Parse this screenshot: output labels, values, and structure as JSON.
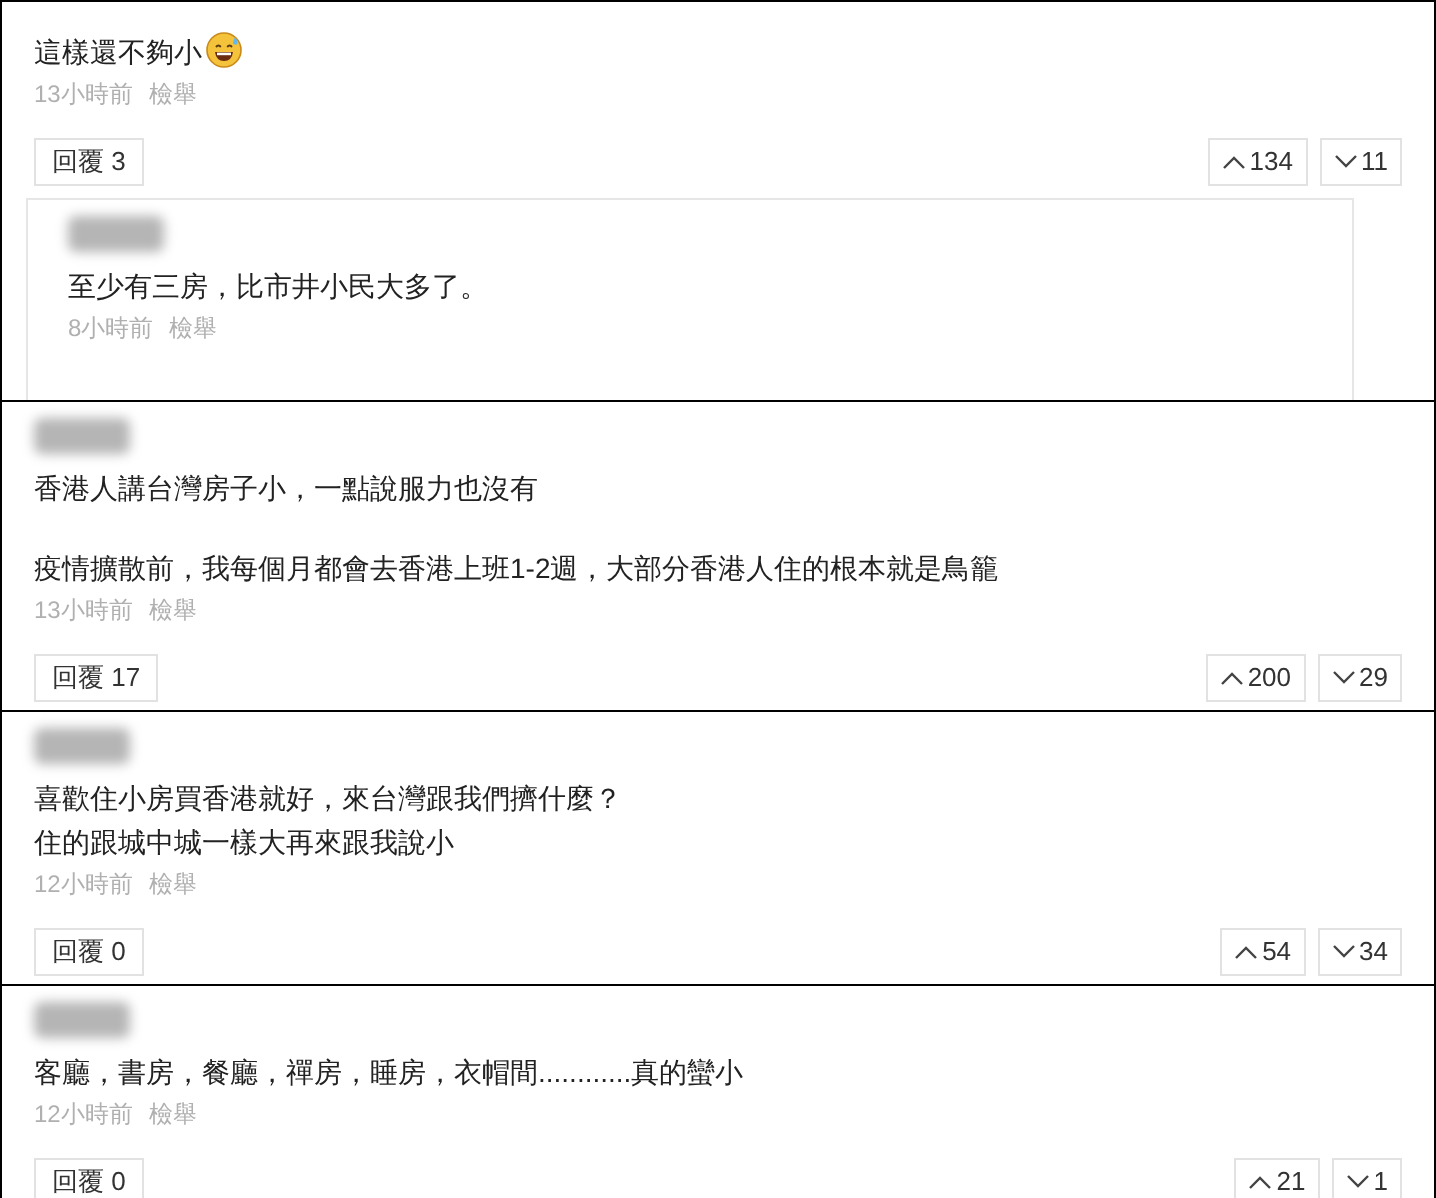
{
  "comments": [
    {
      "paragraphs": [
        [
          "這樣還不夠小"
        ]
      ],
      "has_emoji": true,
      "time": "13小時前",
      "report": "檢舉",
      "reply_button": "回覆 3",
      "upvotes": "134",
      "downvotes": "11",
      "replies": [
        {
          "paragraphs": [
            [
              "至少有三房，比市井小民大多了。"
            ]
          ],
          "time": "8小時前",
          "report": "檢舉"
        }
      ]
    },
    {
      "paragraphs": [
        [
          "香港人講台灣房子小，一點說服力也沒有"
        ],
        [
          "疫情擴散前，我每個月都會去香港上班1-2週，大部分香港人住的根本就是鳥籠"
        ]
      ],
      "has_emoji": false,
      "time": "13小時前",
      "report": "檢舉",
      "reply_button": "回覆 17",
      "upvotes": "200",
      "downvotes": "29"
    },
    {
      "paragraphs": [
        [
          "喜歡住小房買香港就好，來台灣跟我們擠什麼？",
          "住的跟城中城一樣大再來跟我說小"
        ]
      ],
      "has_emoji": false,
      "time": "12小時前",
      "report": "檢舉",
      "reply_button": "回覆 0",
      "upvotes": "54",
      "downvotes": "34"
    },
    {
      "paragraphs": [
        [
          "客廳，書房，餐廳，禪房，睡房，衣帽間............真的蠻小"
        ]
      ],
      "has_emoji": false,
      "time": "12小時前",
      "report": "檢舉",
      "reply_button": "回覆 0",
      "upvotes": "21",
      "downvotes": "1"
    }
  ]
}
